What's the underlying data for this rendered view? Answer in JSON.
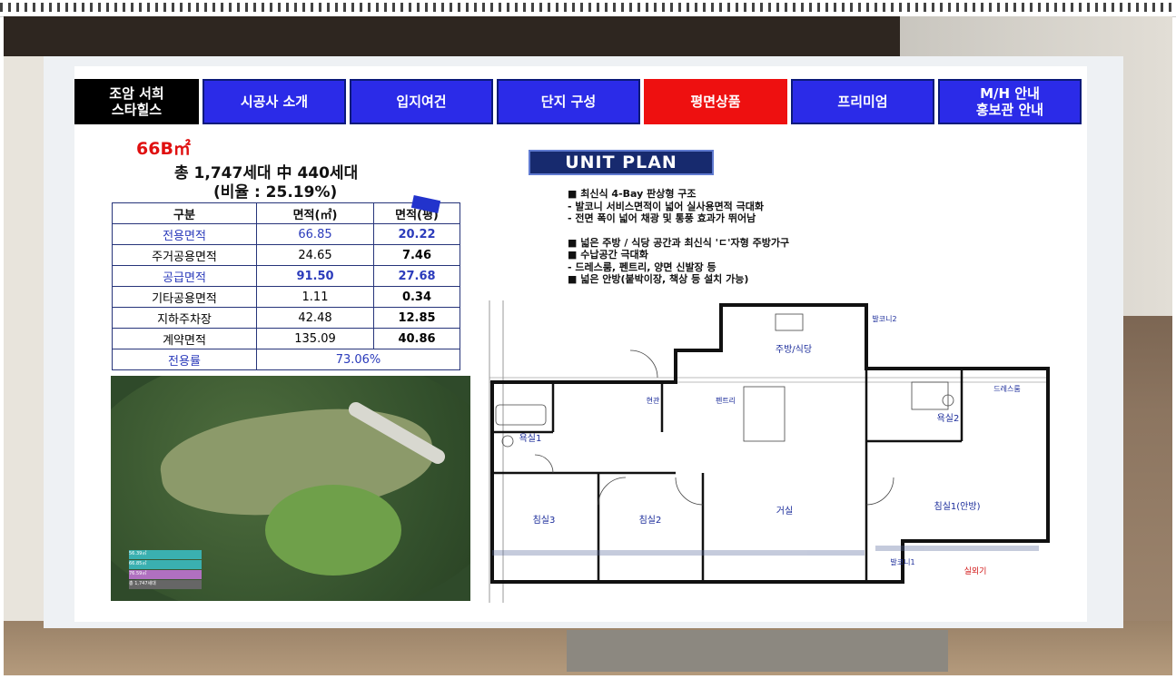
{
  "nav": {
    "brand": [
      "조암 서희",
      "스타힐스"
    ],
    "items": [
      "시공사 소개",
      "입지여건",
      "단지 구성",
      "평면상품",
      "프리미엄"
    ],
    "last": [
      "M/H 안내",
      "홍보관 안내"
    ],
    "active_index": 3,
    "colors": {
      "normal": "#2b2be8",
      "active": "#ee1010",
      "brand": "#000000"
    }
  },
  "unit": {
    "code": "66B㎡",
    "total_line": "총 1,747세대 中 440세대",
    "ratio_line": "(비율 : 25.19%)"
  },
  "area_table": {
    "headers": [
      "구분",
      "면적(㎡)",
      "면적(평)"
    ],
    "rows": [
      {
        "label": "전용면적",
        "m2": "66.85",
        "py": "20.22",
        "highlight": true
      },
      {
        "label": "주거공용면적",
        "m2": "24.65",
        "py": "7.46",
        "highlight": false
      },
      {
        "label": "공급면적",
        "m2": "91.50",
        "py": "27.68",
        "highlight": true
      },
      {
        "label": "기타공용면적",
        "m2": "1.11",
        "py": "0.34",
        "highlight": false
      },
      {
        "label": "지하주차장",
        "m2": "42.48",
        "py": "12.85",
        "highlight": false
      },
      {
        "label": "계약면적",
        "m2": "135.09",
        "py": "40.86",
        "highlight": false
      }
    ],
    "ratio_label": "전용률",
    "ratio_value": "73.06%"
  },
  "site_map": {
    "legend": [
      "56.39㎡",
      "66.85㎡",
      "76.59㎡",
      "총 1,747세대"
    ]
  },
  "unit_plan": {
    "title": "UNIT PLAN",
    "bullets": [
      "■  최신식 4-Bay 판상형 구조",
      " - 발코니 서비스면적이 넓어 실사용면적 극대화",
      " - 전면 폭이 넓어 채광 및 통풍 효과가 뛰어남",
      "",
      "■  넓은 주방 / 식당 공간과 최신식 'ㄷ'자형 주방가구",
      "■  수납공간 극대화",
      " - 드레스룸, 펜트리, 양면 신발장 등",
      "■  넓은 안방(붙박이장, 책상 등 설치 가능)"
    ],
    "rooms": {
      "kitchen": "주방/식당",
      "balcony2": "발코니2",
      "entry": "현관",
      "pantry": "펜트리",
      "bath1": "욕실1",
      "bath2": "욕실2",
      "dress": "드레스룸",
      "bed3": "침실3",
      "bed2": "침실2",
      "living": "거실",
      "bed1": "침실1(안방)",
      "balcony1": "발코니1",
      "outdoor": "실외기"
    }
  }
}
